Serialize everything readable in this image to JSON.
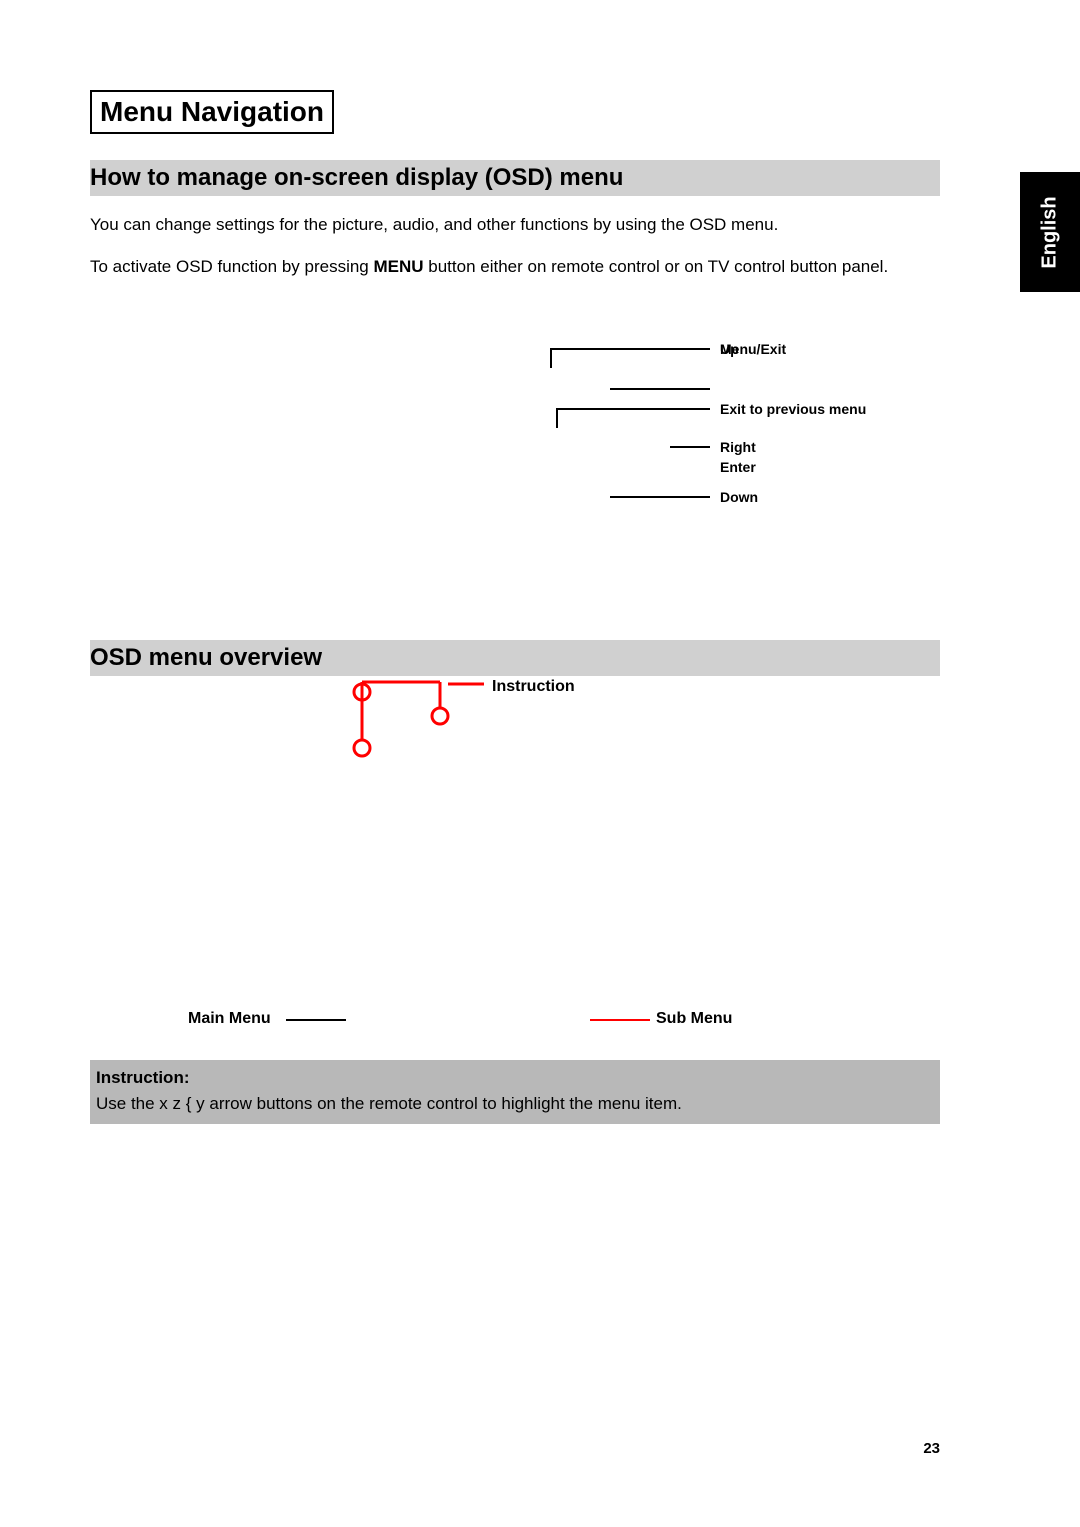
{
  "title": "Menu Navigation",
  "language_tab": "English",
  "page_number": "23",
  "section1": {
    "heading": "How to manage on-screen display (OSD) menu",
    "para1": "You can change settings for the picture, audio, and other functions by using the OSD menu.",
    "para2_pre": "To activate OSD function by pressing ",
    "para2_bold": "MENU",
    "para2_post": " button either on remote control or on TV control button panel."
  },
  "remote_labels": {
    "menu_exit": "Menu/Exit",
    "up": "Up",
    "exit_prev": "Exit to previous menu",
    "right": "Right",
    "enter": "Enter",
    "down": "Down"
  },
  "section2": {
    "heading": "OSD menu overview",
    "instruction_label": "Instruction",
    "main_menu": "Main Menu",
    "sub_menu": "Sub Menu"
  },
  "instruction_box": {
    "heading": "Instruction:",
    "text": "Use the  x z { y     arrow buttons on the remote control to highlight the menu item."
  }
}
